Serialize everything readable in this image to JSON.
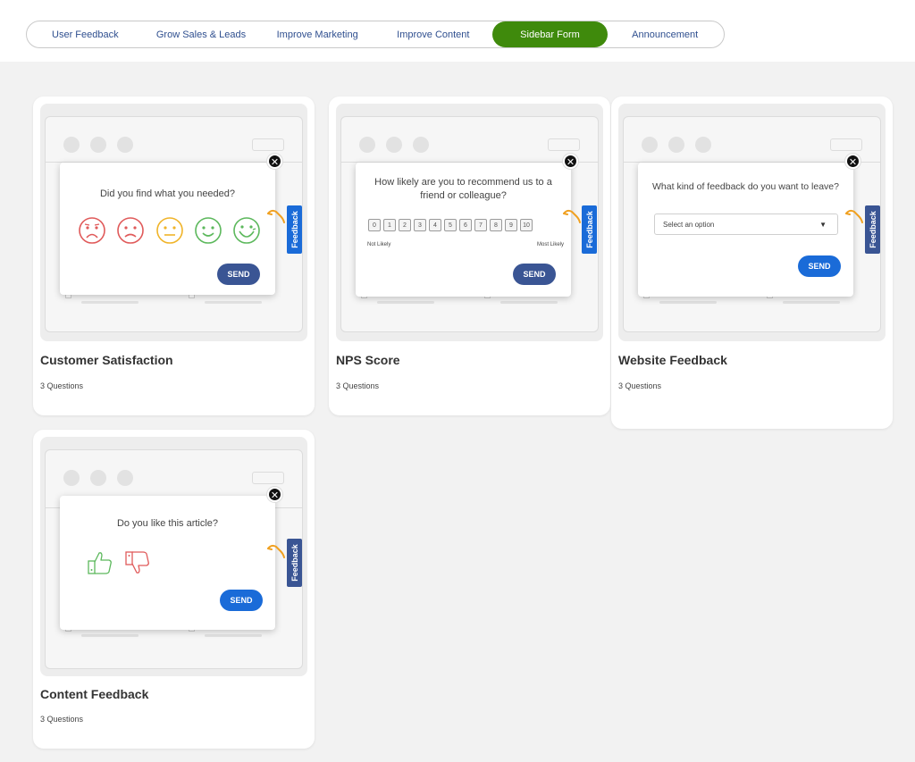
{
  "tabs": [
    {
      "label": "User Feedback",
      "active": false
    },
    {
      "label": "Grow Sales & Leads",
      "active": false
    },
    {
      "label": "Improve Marketing",
      "active": false
    },
    {
      "label": "Improve Content",
      "active": false
    },
    {
      "label": "Sidebar Form",
      "active": true
    },
    {
      "label": "Announcement",
      "active": false
    }
  ],
  "colors": {
    "active_tab": "#3f8a0c",
    "navy": "#3a5594",
    "blue": "#1a6bd8",
    "sad": "#e05a5a",
    "neutral": "#f0b429",
    "happy": "#5cb85c"
  },
  "cards": [
    {
      "title": "Customer Satisfaction",
      "subtitle": "3 Questions",
      "question": "Did you find what you needed?",
      "send_label": "SEND",
      "feedback_tab": "Feedback",
      "icons": [
        "very-sad-face-icon",
        "sad-face-icon",
        "neutral-face-icon",
        "happy-face-icon",
        "very-happy-face-icon"
      ]
    },
    {
      "title": "NPS Score",
      "subtitle": "3 Questions",
      "question": "How likely are you to recommend us to a friend or colleague?",
      "scale": [
        "0",
        "1",
        "2",
        "3",
        "4",
        "5",
        "6",
        "7",
        "8",
        "9",
        "10"
      ],
      "low_label": "Not Likely",
      "high_label": "Most Likely",
      "send_label": "SEND",
      "feedback_tab": "Feedback"
    },
    {
      "title": "Website Feedback",
      "subtitle": "3 Questions",
      "question": "What kind of feedback do you want to leave?",
      "select_placeholder": "Select an option",
      "send_label": "SEND",
      "feedback_tab": "Feedback"
    },
    {
      "title": "Content Feedback",
      "subtitle": "3 Questions",
      "question": "Do you like this article?",
      "send_label": "SEND",
      "feedback_tab": "Feedback",
      "icons": [
        "thumbs-up-icon",
        "thumbs-down-icon"
      ]
    }
  ]
}
